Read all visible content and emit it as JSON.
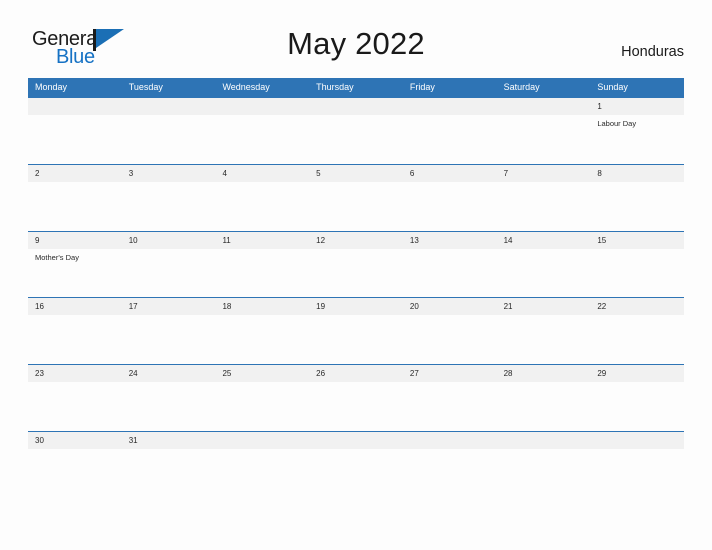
{
  "branding": {
    "logo_text_primary": "General",
    "logo_text_secondary": "Blue",
    "flag_icon": "blue-flag-icon"
  },
  "header": {
    "title": "May 2022",
    "country": "Honduras"
  },
  "colors": {
    "header_blue": "#2e74b5",
    "row_divider_blue": "#2e74b5",
    "date_band_gray": "#f1f1f1",
    "logo_blue": "#1672c4",
    "page_background": "#fdfdfd",
    "text_dark": "#1a1a1a"
  },
  "calendar": {
    "month": "May",
    "year": "2022",
    "weekday_headers": [
      "Monday",
      "Tuesday",
      "Wednesday",
      "Thursday",
      "Friday",
      "Saturday",
      "Sunday"
    ],
    "weeks": [
      {
        "days": [
          {
            "date": "",
            "event": ""
          },
          {
            "date": "",
            "event": ""
          },
          {
            "date": "",
            "event": ""
          },
          {
            "date": "",
            "event": ""
          },
          {
            "date": "",
            "event": ""
          },
          {
            "date": "",
            "event": ""
          },
          {
            "date": "1",
            "event": "Labour Day"
          }
        ]
      },
      {
        "days": [
          {
            "date": "2",
            "event": ""
          },
          {
            "date": "3",
            "event": ""
          },
          {
            "date": "4",
            "event": ""
          },
          {
            "date": "5",
            "event": ""
          },
          {
            "date": "6",
            "event": ""
          },
          {
            "date": "7",
            "event": ""
          },
          {
            "date": "8",
            "event": ""
          }
        ]
      },
      {
        "days": [
          {
            "date": "9",
            "event": "Mother's Day"
          },
          {
            "date": "10",
            "event": ""
          },
          {
            "date": "11",
            "event": ""
          },
          {
            "date": "12",
            "event": ""
          },
          {
            "date": "13",
            "event": ""
          },
          {
            "date": "14",
            "event": ""
          },
          {
            "date": "15",
            "event": ""
          }
        ]
      },
      {
        "days": [
          {
            "date": "16",
            "event": ""
          },
          {
            "date": "17",
            "event": ""
          },
          {
            "date": "18",
            "event": ""
          },
          {
            "date": "19",
            "event": ""
          },
          {
            "date": "20",
            "event": ""
          },
          {
            "date": "21",
            "event": ""
          },
          {
            "date": "22",
            "event": ""
          }
        ]
      },
      {
        "days": [
          {
            "date": "23",
            "event": ""
          },
          {
            "date": "24",
            "event": ""
          },
          {
            "date": "25",
            "event": ""
          },
          {
            "date": "26",
            "event": ""
          },
          {
            "date": "27",
            "event": ""
          },
          {
            "date": "28",
            "event": ""
          },
          {
            "date": "29",
            "event": ""
          }
        ]
      },
      {
        "days": [
          {
            "date": "30",
            "event": ""
          },
          {
            "date": "31",
            "event": ""
          },
          {
            "date": "",
            "event": ""
          },
          {
            "date": "",
            "event": ""
          },
          {
            "date": "",
            "event": ""
          },
          {
            "date": "",
            "event": ""
          },
          {
            "date": "",
            "event": ""
          }
        ]
      }
    ]
  }
}
